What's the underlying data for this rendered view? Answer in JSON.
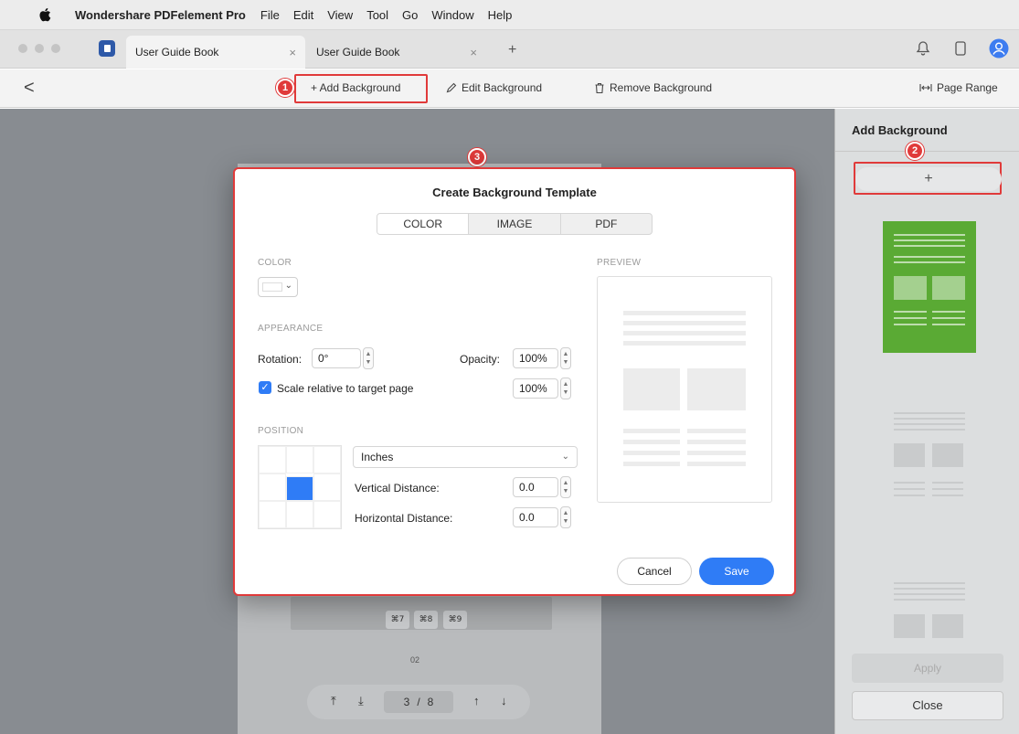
{
  "menubar": {
    "app_name": "Wondershare PDFelement Pro",
    "items": [
      "File",
      "Edit",
      "View",
      "Tool",
      "Go",
      "Window",
      "Help"
    ]
  },
  "tabs": [
    {
      "label": "User Guide Book",
      "close": "×"
    },
    {
      "label": "User Guide Book",
      "close": "×"
    }
  ],
  "tab_add": "+",
  "toolbar": {
    "back": "<",
    "add_background": "+ Add Background",
    "edit_background": "Edit Background",
    "remove_background": "Remove Background",
    "page_range": "Page Range"
  },
  "callouts": {
    "one": "1",
    "two": "2",
    "three": "3"
  },
  "document": {
    "shortcuts": [
      "⌘7",
      "⌘8",
      "⌘9"
    ],
    "page_label": "02"
  },
  "pager": {
    "current": "3",
    "separator": "/",
    "total": "8"
  },
  "right_panel": {
    "title": "Add Background",
    "add_button": "+",
    "apply": "Apply",
    "close": "Close"
  },
  "dialog": {
    "title": "Create Background Template",
    "segments": [
      "COLOR",
      "IMAGE",
      "PDF"
    ],
    "active_segment": "COLOR",
    "color_section": "COLOR",
    "appearance_section": "APPEARANCE",
    "rotation_label": "Rotation:",
    "rotation_value": "0°",
    "opacity_label": "Opacity:",
    "opacity_value": "100%",
    "scale_label": "Scale relative to target page",
    "scale_checked": true,
    "scale_value": "100%",
    "position_section": "POSITION",
    "units": "Inches",
    "vertical_label": "Vertical Distance:",
    "vertical_value": "0.0",
    "horizontal_label": "Horizontal Distance:",
    "horizontal_value": "0.0",
    "preview_section": "PREVIEW",
    "cancel": "Cancel",
    "save": "Save"
  },
  "colors": {
    "accent_blue": "#2f7cf6",
    "callout_red": "#e03a3a",
    "thumbnail_green": "#5aaa34"
  }
}
